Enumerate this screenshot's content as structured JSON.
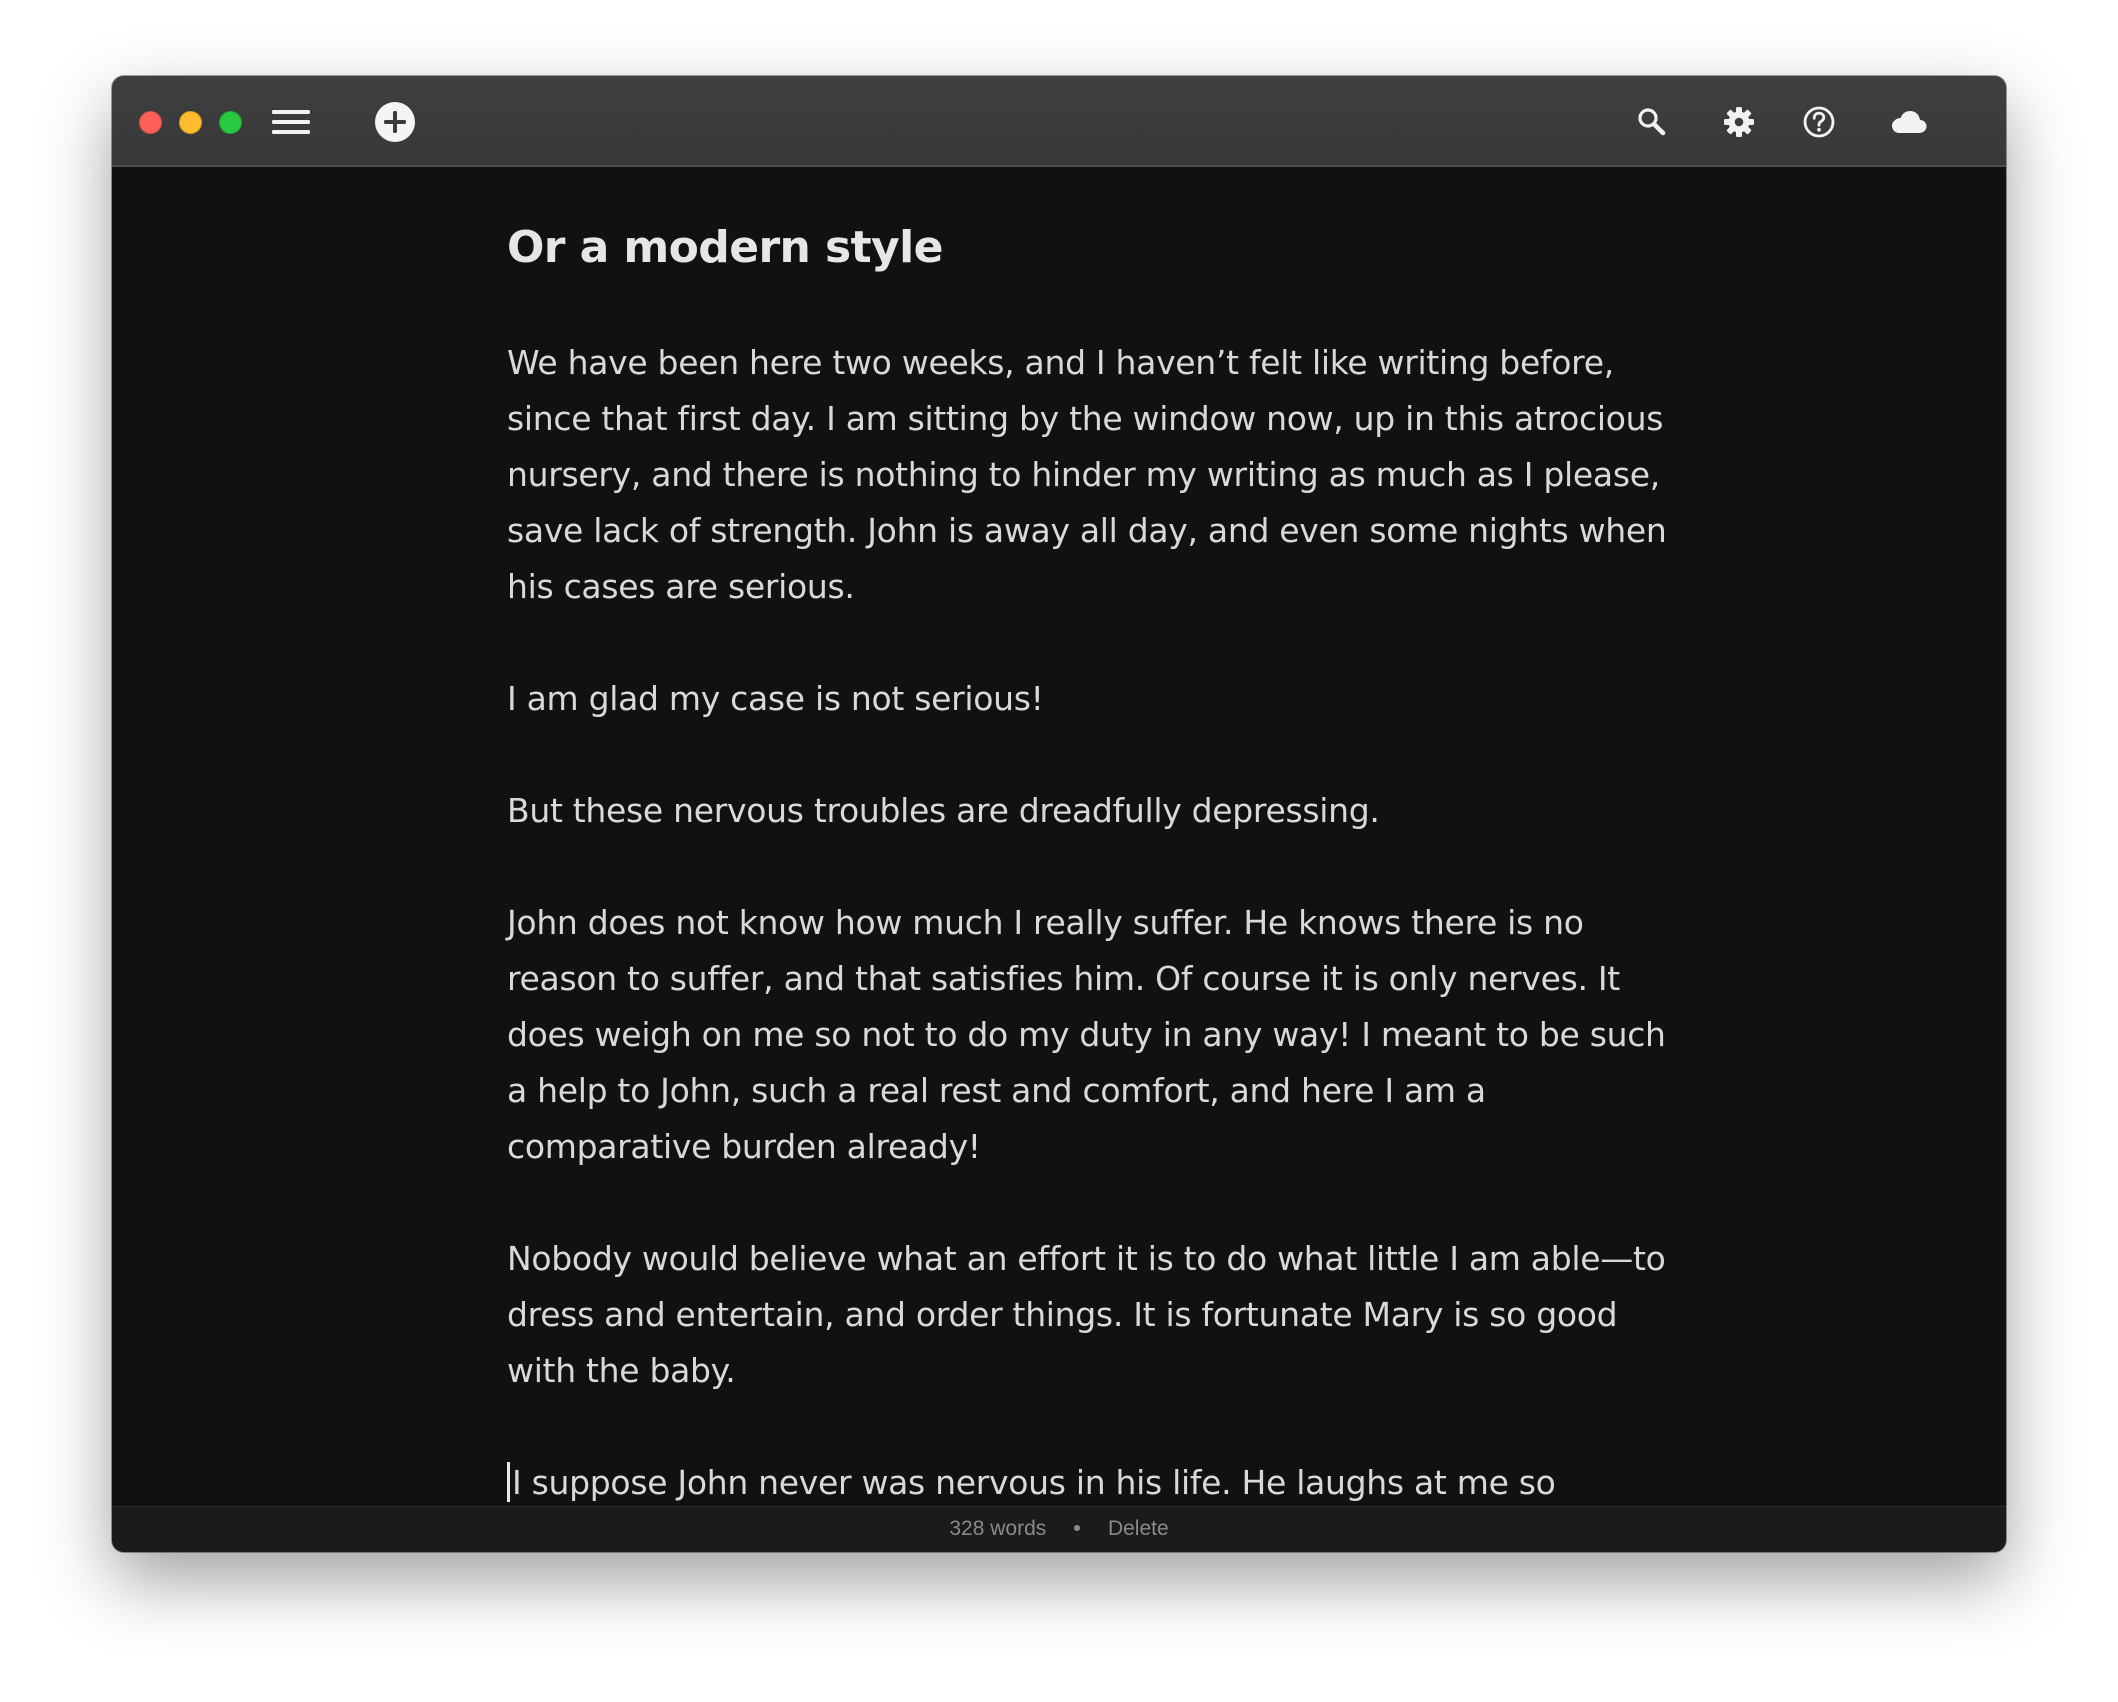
{
  "window": {
    "controls": [
      "close",
      "minimize",
      "maximize"
    ]
  },
  "toolbar": {
    "left_icons": [
      "menu-icon",
      "new-document-icon"
    ],
    "right_icons": [
      "search-icon",
      "gear-icon",
      "help-icon",
      "cloud-icon"
    ]
  },
  "document": {
    "title": "Or a modern style",
    "paragraphs": [
      "We have been here two weeks, and I haven’t felt like writing before, since that first day. I am sitting by the window now, up in this atrocious nursery, and there is nothing to hinder my writing as much as I please, save lack of strength. John is away all day, and even some nights when his cases are serious.",
      "I am glad my case is not serious!",
      "But these nervous troubles are dreadfully depressing.",
      "John does not know how much I really suffer. He knows there is no reason to suffer, and that satisfies him. Of course it is only nerves. It does weigh on me so not to do my duty in any way! I meant to be such a help to John, such a real rest and comfort, and here I am a comparative burden already!",
      "Nobody would believe what an effort it is to do what little I am able—to dress and entertain, and order things. It is fortunate Mary is so good with the baby.",
      "I suppose John never was nervous in his life. He laughs at me so"
    ]
  },
  "statusbar": {
    "word_count": "328 words",
    "delete_label": "Delete"
  }
}
